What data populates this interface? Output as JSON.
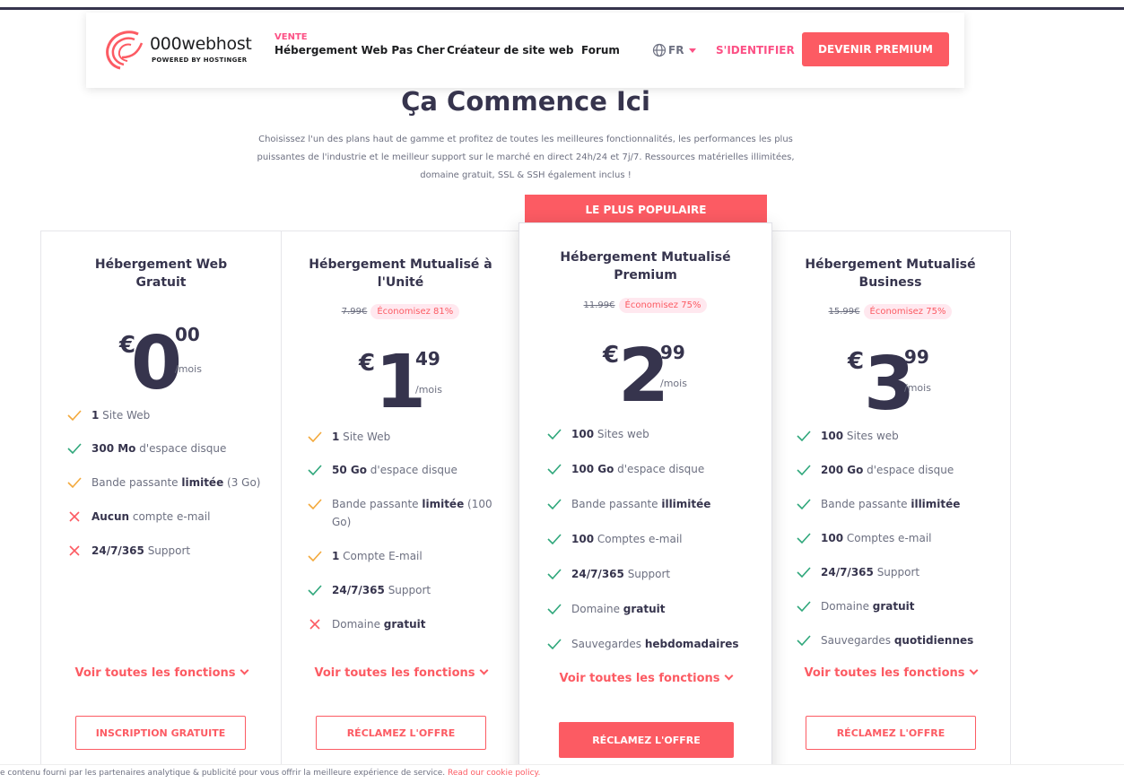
{
  "colors": {
    "accent": "#fc5b63",
    "heading": "#36344d",
    "check_green": "#2fa77b",
    "check_orange": "#f3a93c",
    "cross_red": "#fc5b63"
  },
  "nav": {
    "logo_name": "000webhost",
    "logo_sub": "POWERED BY HOSTINGER",
    "vente": "VENTE",
    "links": [
      "Hébergement Web Pas Cher",
      "Créateur de site web",
      "Forum"
    ],
    "lang": "FR",
    "signin": "S'IDENTIFIER",
    "premium": "DEVENIR PREMIUM"
  },
  "hero": {
    "title": "Ça Commence Ici",
    "desc_1": "Choisissez l'un des plans haut de gamme et profitez de toutes les meilleures fonctionnalités, les performances les plus",
    "desc_2": "puissantes de l'industrie et le meilleur support sur le marché en direct 24h/24 et 7j/7. Ressources matérielles illimitées,",
    "desc_3": "domaine gratuit, SSL & SSH également inclus !"
  },
  "popular_badge": "LE PLUS POPULAIRE",
  "plans": [
    {
      "title_1": "Hébergement Web Gratuit",
      "title_2": "",
      "old_price": "",
      "save": "",
      "currency": "€",
      "amount": "0",
      "cents": "00",
      "period": "/mois",
      "features": [
        {
          "icon": "check",
          "color": "orange",
          "b": "1",
          "t": " Site Web",
          "b2": "",
          "t2": ""
        },
        {
          "icon": "check",
          "color": "green",
          "b": "300 Mo",
          "t": " d'espace disque",
          "b2": "",
          "t2": ""
        },
        {
          "icon": "check",
          "color": "orange",
          "b": "",
          "t": "Bande passante ",
          "b2": "limitée",
          "t2": " (3 Go)"
        },
        {
          "icon": "cross",
          "color": "red",
          "b": "Aucun",
          "t": " compte e-mail",
          "b2": "",
          "t2": ""
        },
        {
          "icon": "cross",
          "color": "red",
          "b": "24/7/365",
          "t": " Support",
          "b2": "",
          "t2": ""
        }
      ],
      "see_all": "Voir toutes les fonctions",
      "cta": "INSCRIPTION GRATUITE"
    },
    {
      "title_1": "Hébergement Mutualisé à",
      "title_2": "l'Unité",
      "old_price": "7.99€",
      "save": "Économisez 81%",
      "currency": "€",
      "amount": "1",
      "cents": "49",
      "period": "/mois",
      "features": [
        {
          "icon": "check",
          "color": "orange",
          "b": "1",
          "t": " Site Web",
          "b2": "",
          "t2": ""
        },
        {
          "icon": "check",
          "color": "green",
          "b": "50 Go",
          "t": " d'espace disque",
          "b2": "",
          "t2": ""
        },
        {
          "icon": "check",
          "color": "orange",
          "b": "",
          "t": "Bande passante ",
          "b2": "limitée",
          "t2": " (100"
        },
        {
          "icon": "none",
          "color": "",
          "b": "",
          "t": "Go)",
          "b2": "",
          "t2": ""
        },
        {
          "icon": "check",
          "color": "orange",
          "b": "1",
          "t": " Compte E-mail",
          "b2": "",
          "t2": ""
        },
        {
          "icon": "check",
          "color": "green",
          "b": "24/7/365",
          "t": " Support",
          "b2": "",
          "t2": ""
        },
        {
          "icon": "cross",
          "color": "red",
          "b": "",
          "t": "Domaine ",
          "b2": "gratuit",
          "t2": ""
        }
      ],
      "see_all": "Voir toutes les fonctions",
      "cta": "RÉCLAMEZ L'OFFRE"
    },
    {
      "title_1": "Hébergement Mutualisé",
      "title_2": "Premium",
      "old_price": "11.99€",
      "save": "Économisez 75%",
      "currency": "€",
      "amount": "2",
      "cents": "99",
      "period": "/mois",
      "features": [
        {
          "icon": "check",
          "color": "green",
          "b": "100",
          "t": " Sites web",
          "b2": "",
          "t2": ""
        },
        {
          "icon": "check",
          "color": "green",
          "b": "100 Go",
          "t": " d'espace disque",
          "b2": "",
          "t2": ""
        },
        {
          "icon": "check",
          "color": "green",
          "b": "",
          "t": "Bande passante ",
          "b2": "illimitée",
          "t2": ""
        },
        {
          "icon": "check",
          "color": "green",
          "b": "100",
          "t": " Comptes e-mail",
          "b2": "",
          "t2": ""
        },
        {
          "icon": "check",
          "color": "green",
          "b": "24/7/365",
          "t": " Support",
          "b2": "",
          "t2": ""
        },
        {
          "icon": "check",
          "color": "green",
          "b": "",
          "t": "Domaine ",
          "b2": "gratuit",
          "t2": ""
        },
        {
          "icon": "check",
          "color": "green",
          "b": "",
          "t": "Sauvegardes ",
          "b2": "hebdomadaires",
          "t2": ""
        }
      ],
      "see_all": "Voir toutes les fonctions",
      "cta": "RÉCLAMEZ L'OFFRE"
    },
    {
      "title_1": "Hébergement Mutualisé",
      "title_2": "Business",
      "old_price": "15.99€",
      "save": "Économisez 75%",
      "currency": "€",
      "amount": "3",
      "cents": "99",
      "period": "/mois",
      "features": [
        {
          "icon": "check",
          "color": "green",
          "b": "100",
          "t": " Sites web",
          "b2": "",
          "t2": ""
        },
        {
          "icon": "check",
          "color": "green",
          "b": "200 Go",
          "t": " d'espace disque",
          "b2": "",
          "t2": ""
        },
        {
          "icon": "check",
          "color": "green",
          "b": "",
          "t": "Bande passante ",
          "b2": "illimitée",
          "t2": ""
        },
        {
          "icon": "check",
          "color": "green",
          "b": "100",
          "t": " Comptes e-mail",
          "b2": "",
          "t2": ""
        },
        {
          "icon": "check",
          "color": "green",
          "b": "24/7/365",
          "t": " Support",
          "b2": "",
          "t2": ""
        },
        {
          "icon": "check",
          "color": "green",
          "b": "",
          "t": "Domaine ",
          "b2": "gratuit",
          "t2": ""
        },
        {
          "icon": "check",
          "color": "green",
          "b": "",
          "t": "Sauvegardes ",
          "b2": "quotidiennes",
          "t2": ""
        }
      ],
      "see_all": "Voir toutes les fonctions",
      "cta": "RÉCLAMEZ L'OFFRE"
    }
  ],
  "cookie": {
    "text": "e contenu fourni par les partenaires analytique & publicité pour vous offrir la meilleure expérience de service. ",
    "link": "Read our cookie policy."
  }
}
